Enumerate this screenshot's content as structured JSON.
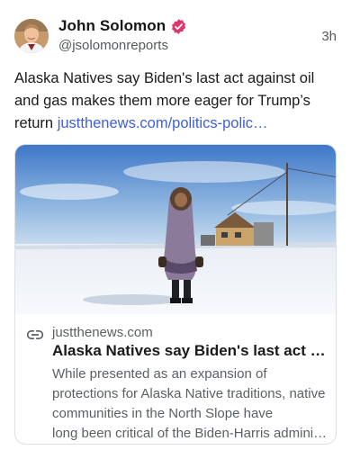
{
  "post": {
    "author": {
      "display_name": "John Solomon",
      "handle": "@jsolomonreports",
      "verified": true,
      "avatar_icon": "profile-photo"
    },
    "timestamp": "3h",
    "text": "Alaska Natives say Biden's last act against oil and gas makes them more eager for Trump’s return ",
    "link_text": "justthenews.com/politics-polic…"
  },
  "card": {
    "image_icon": "photo-person-in-parka-on-snow",
    "link_icon": "chain-link-icon",
    "domain": "justthenews.com",
    "title": "Alaska Natives say Biden's last act ag…",
    "description": "While presented as an expansion of protections for Alaska Native traditions, native communities in the North Slope have",
    "description_last": "long been critical of the Biden-Harris admini…"
  },
  "colors": {
    "link": "#3f5fd6",
    "verified_badge": "#e0366b",
    "secondary_text": "#555a60"
  }
}
